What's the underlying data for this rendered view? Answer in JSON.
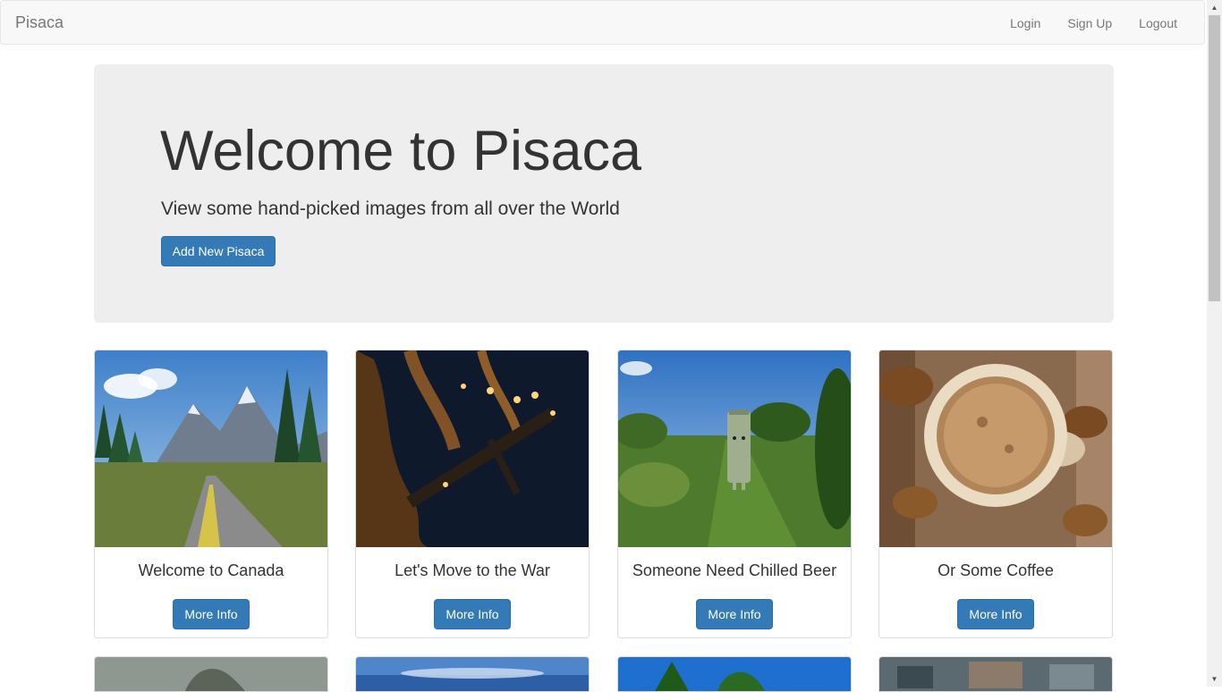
{
  "navbar": {
    "brand": "Pisaca",
    "links": [
      "Login",
      "Sign Up",
      "Logout"
    ]
  },
  "jumbotron": {
    "title": "Welcome to Pisaca",
    "subtitle": "View some hand-picked images from all over the World",
    "button_label": "Add New Pisaca"
  },
  "cards": [
    {
      "title": "Welcome to Canada",
      "button_label": "More Info"
    },
    {
      "title": "Let's Move to the War",
      "button_label": "More Info"
    },
    {
      "title": "Someone Need Chilled Beer",
      "button_label": "More Info"
    },
    {
      "title": "Or Some Coffee",
      "button_label": "More Info"
    }
  ],
  "colors": {
    "primary": "#337ab7",
    "navbar_bg": "#f8f8f8",
    "jumbotron_bg": "#eeeeee"
  }
}
